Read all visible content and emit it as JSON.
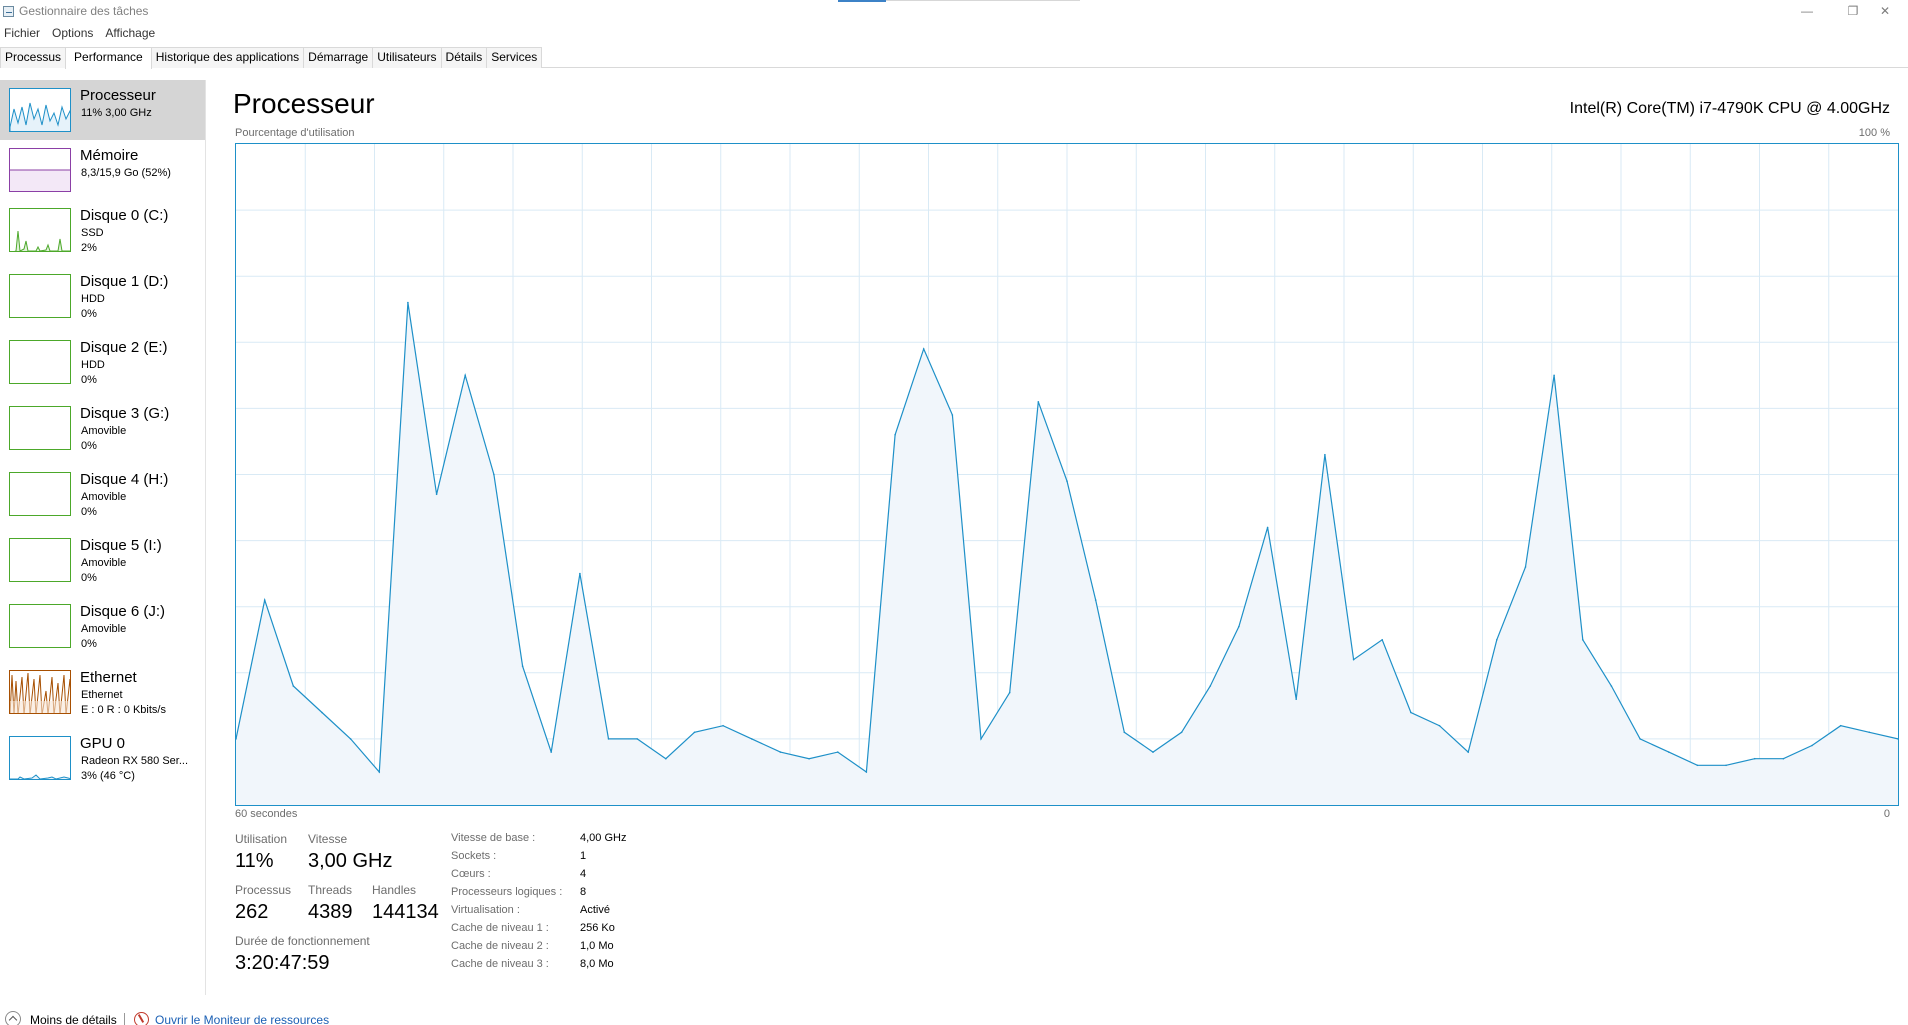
{
  "window": {
    "title": "Gestionnaire des tâches",
    "minimize": "—",
    "restore": "❐",
    "close": "✕"
  },
  "menu": [
    "Fichier",
    "Options",
    "Affichage"
  ],
  "tabs": [
    "Processus",
    "Performance",
    "Historique des applications",
    "Démarrage",
    "Utilisateurs",
    "Détails",
    "Services"
  ],
  "active_tab": "Performance",
  "sidebar": {
    "items": [
      {
        "name": "Processeur",
        "lines": [
          "11% 3,00 GHz"
        ],
        "color": "#1e90c8",
        "selected": true
      },
      {
        "name": "Mémoire",
        "lines": [
          "8,3/15,9 Go (52%)"
        ],
        "color": "#8b3fa6"
      },
      {
        "name": "Disque 0 (C:)",
        "lines": [
          "SSD",
          "2%"
        ],
        "color": "#4ca82a"
      },
      {
        "name": "Disque 1 (D:)",
        "lines": [
          "HDD",
          "0%"
        ],
        "color": "#4ca82a"
      },
      {
        "name": "Disque 2 (E:)",
        "lines": [
          "HDD",
          "0%"
        ],
        "color": "#4ca82a"
      },
      {
        "name": "Disque 3 (G:)",
        "lines": [
          "Amovible",
          "0%"
        ],
        "color": "#4ca82a"
      },
      {
        "name": "Disque 4 (H:)",
        "lines": [
          "Amovible",
          "0%"
        ],
        "color": "#4ca82a"
      },
      {
        "name": "Disque 5 (I:)",
        "lines": [
          "Amovible",
          "0%"
        ],
        "color": "#4ca82a"
      },
      {
        "name": "Disque 6 (J:)",
        "lines": [
          "Amovible",
          "0%"
        ],
        "color": "#4ca82a"
      },
      {
        "name": "Ethernet",
        "lines": [
          "Ethernet",
          "E : 0 R : 0 Kbits/s"
        ],
        "color": "#a74f01"
      },
      {
        "name": "GPU 0",
        "lines": [
          "Radeon RX 580 Ser...",
          "3% (46 °C)"
        ],
        "color": "#1e90c8"
      }
    ]
  },
  "main": {
    "title": "Processeur",
    "cpu_model": "Intel(R) Core(TM) i7-4790K CPU @ 4.00GHz",
    "graph_label": "Pourcentage d'utilisation",
    "graph_max": "100 %",
    "axis_left": "60 secondes",
    "axis_right": "0",
    "stats": {
      "utilisation_label": "Utilisation",
      "utilisation_value": "11%",
      "vitesse_label": "Vitesse",
      "vitesse_value": "3,00 GHz",
      "processus_label": "Processus",
      "processus_value": "262",
      "threads_label": "Threads",
      "threads_value": "4389",
      "handles_label": "Handles",
      "handles_value": "144134",
      "uptime_label": "Durée de fonctionnement",
      "uptime_value": "3:20:47:59"
    },
    "details": [
      {
        "label": "Vitesse de base :",
        "value": "4,00 GHz"
      },
      {
        "label": "Sockets :",
        "value": "1"
      },
      {
        "label": "Cœurs :",
        "value": "4"
      },
      {
        "label": "Processeurs logiques :",
        "value": "8"
      },
      {
        "label": "Virtualisation :",
        "value": "Activé"
      },
      {
        "label": "Cache de niveau 1 :",
        "value": "256 Ko"
      },
      {
        "label": "Cache de niveau 2 :",
        "value": "1,0 Mo"
      },
      {
        "label": "Cache de niveau 3 :",
        "value": "8,0 Mo"
      }
    ]
  },
  "footer": {
    "less_details": "Moins de détails",
    "resource_monitor": "Ouvrir le Moniteur de ressources"
  },
  "chart_data": {
    "type": "area",
    "x": [
      60,
      59,
      58,
      57,
      56,
      55,
      54,
      53,
      52,
      51,
      50,
      49,
      48,
      47,
      46,
      45,
      44,
      43,
      42,
      41,
      40,
      39,
      38,
      37,
      36,
      35,
      34,
      33,
      32,
      31,
      31,
      30,
      29,
      28,
      27,
      26,
      25,
      24,
      23,
      22,
      21,
      20,
      19,
      18,
      17,
      16,
      15,
      14,
      13,
      12,
      11,
      10,
      9,
      8,
      7,
      6,
      5,
      4,
      3,
      2,
      1,
      0
    ],
    "values": [
      10,
      31,
      18,
      14,
      10,
      5,
      76,
      47,
      65,
      50,
      21,
      8,
      35,
      10,
      10,
      7,
      11,
      12,
      10,
      8,
      7,
      8,
      5,
      56,
      69,
      59,
      10,
      17,
      61,
      49,
      31,
      11,
      8,
      11,
      18,
      27,
      42,
      16,
      53,
      22,
      25,
      14,
      12,
      8,
      25,
      36,
      65,
      25,
      18,
      10,
      8,
      6,
      6,
      7,
      7,
      9,
      12,
      11,
      10
    ],
    "xlabel": "60 secondes",
    "ylabel": "Pourcentage d'utilisation",
    "ylim": [
      0,
      100
    ],
    "grid": true,
    "color": "#1e90c8"
  }
}
